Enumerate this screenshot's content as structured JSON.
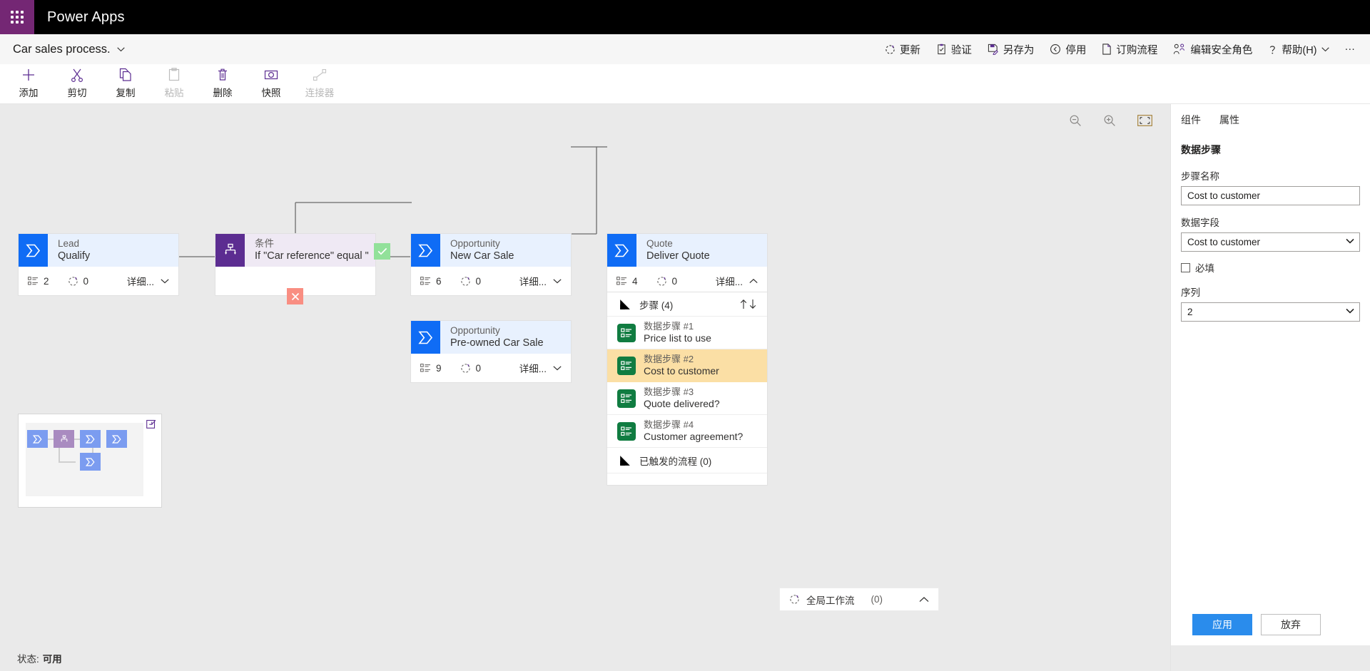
{
  "suite": {
    "app_name": "Power Apps",
    "waffle_icon": "app-launcher-icon"
  },
  "command_bar": {
    "process_title": "Car sales process.",
    "actions": [
      {
        "label": "更新",
        "icon": "refresh-icon"
      },
      {
        "label": "验证",
        "icon": "clipboard-check-icon"
      },
      {
        "label": "另存为",
        "icon": "save-as-icon"
      },
      {
        "label": "停用",
        "icon": "deactivate-icon"
      },
      {
        "label": "订购流程",
        "icon": "order-process-icon"
      },
      {
        "label": "编辑安全角色",
        "icon": "security-roles-icon"
      },
      {
        "label": "帮助(H)",
        "icon": "help-icon"
      }
    ],
    "overflow_label": "···"
  },
  "ribbon": {
    "tools": [
      {
        "label": "添加",
        "icon": "add-icon",
        "disabled": false
      },
      {
        "label": "剪切",
        "icon": "scissors-icon",
        "disabled": false
      },
      {
        "label": "复制",
        "icon": "copy-icon",
        "disabled": false
      },
      {
        "label": "粘贴",
        "icon": "paste-icon",
        "disabled": true
      },
      {
        "label": "删除",
        "icon": "trash-icon",
        "disabled": false
      },
      {
        "label": "快照",
        "icon": "camera-icon",
        "disabled": false
      },
      {
        "label": "连接器",
        "icon": "connector-icon",
        "disabled": true
      }
    ]
  },
  "canvas": {
    "zoom_controls": [
      {
        "name": "zoom-out-icon"
      },
      {
        "name": "zoom-in-icon"
      },
      {
        "name": "fit-to-screen-icon"
      }
    ],
    "stages": [
      {
        "entity": "Lead",
        "name": "Qualify",
        "steps_count": "2",
        "flows_count": "0",
        "details_label": "详细...",
        "expanded": false
      },
      {
        "entity": "条件",
        "name": "If \"Car reference\" equal \"New car...",
        "type": "condition"
      },
      {
        "entity": "Opportunity",
        "name": "New Car Sale",
        "steps_count": "6",
        "flows_count": "0",
        "details_label": "详细...",
        "expanded": false
      },
      {
        "entity": "Opportunity",
        "name": "Pre-owned Car Sale",
        "steps_count": "9",
        "flows_count": "0",
        "details_label": "详细...",
        "expanded": false
      },
      {
        "entity": "Quote",
        "name": "Deliver Quote",
        "steps_count": "4",
        "flows_count": "0",
        "details_label": "详细...",
        "expanded": true
      }
    ],
    "branch_labels": {
      "yes": "✓",
      "no": "✕"
    },
    "steps_panel": {
      "header": "步骤 (4)",
      "sort_up_icon": "arrow-up-icon",
      "sort_down_icon": "arrow-down-icon",
      "steps": [
        {
          "title": "数据步骤 #1",
          "subtitle": "Price list to use",
          "selected": false
        },
        {
          "title": "数据步骤 #2",
          "subtitle": "Cost to customer",
          "selected": true
        },
        {
          "title": "数据步骤 #3",
          "subtitle": "Quote delivered?",
          "selected": false
        },
        {
          "title": "数据步骤 #4",
          "subtitle": "Customer agreement?",
          "selected": false
        }
      ],
      "flows_row": "已触发的流程 (0)"
    },
    "minimap": {
      "collapse_icon": "collapse-minimap-icon"
    },
    "global_workflows": {
      "label": "全局工作流",
      "count": "(0)",
      "icon": "flow-icon",
      "chevron": "chevron-up-icon"
    }
  },
  "status_bar": {
    "label": "状态:",
    "value": "可用"
  },
  "properties": {
    "tabs": [
      {
        "label": "组件"
      },
      {
        "label": "属性"
      }
    ],
    "heading": "数据步骤",
    "step_name_label": "步骤名称",
    "step_name_value": "Cost to customer",
    "data_field_label": "数据字段",
    "data_field_value": "Cost to customer",
    "required_label": "必填",
    "required_checked": false,
    "sequence_label": "序列",
    "sequence_value": "2",
    "apply_label": "应用",
    "discard_label": "放弃"
  },
  "colors": {
    "brand_purple": "#742774",
    "stage_blue": "#0f6cf5",
    "condition_purple": "#5c2d91",
    "step_green": "#107c41",
    "selected_amber": "#fbdfa5",
    "primary_button": "#2a8cec",
    "yes_branch": "#92e19a",
    "no_branch": "#f98e82"
  }
}
